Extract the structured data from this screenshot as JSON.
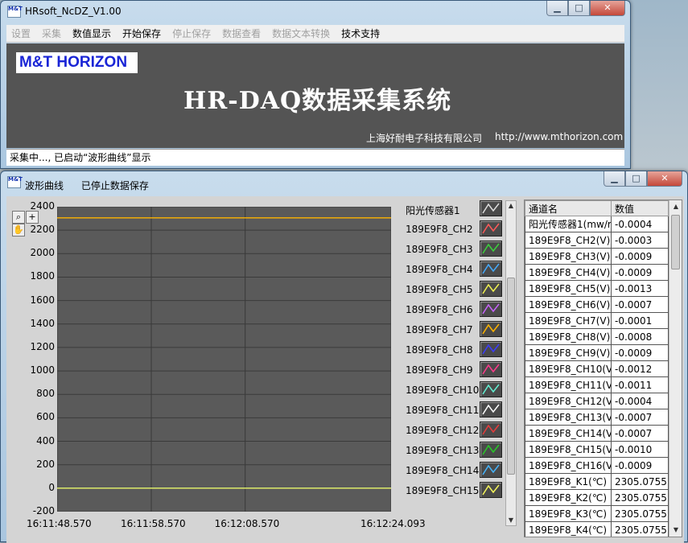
{
  "window1": {
    "title": "HRsoft_NcDZ_V1.00",
    "icon_text": "M&T",
    "menu": [
      {
        "label": "设置",
        "enabled": false
      },
      {
        "label": "采集",
        "enabled": false
      },
      {
        "label": "数值显示",
        "enabled": true
      },
      {
        "label": "开始保存",
        "enabled": true
      },
      {
        "label": "停止保存",
        "enabled": false
      },
      {
        "label": "数据查看",
        "enabled": false
      },
      {
        "label": "数据文本转换",
        "enabled": false
      },
      {
        "label": "技术支持",
        "enabled": true
      }
    ],
    "logo": "M&T HORIZON",
    "system_title": "HR-DAQ数据采集系统",
    "company": "上海好耐电子科技有限公司",
    "website": "http://www.mthorizon.com",
    "status": "采集中..., 已启动“波形曲线”显示"
  },
  "window2": {
    "status_left": "波形曲线",
    "status_right": "已停止数据保存",
    "chart_data": {
      "type": "line",
      "y_ticks": [
        "2400",
        "2200",
        "2000",
        "1800",
        "1600",
        "1400",
        "1200",
        "1000",
        "800",
        "600",
        "400",
        "200",
        "0",
        "-200"
      ],
      "ylim": [
        -200,
        2400
      ],
      "x_ticks": [
        "16:11:48.570",
        "16:11:58.570",
        "16:12:08.570",
        "16:12:24.093"
      ],
      "grid": true,
      "series": [
        {
          "name": "阳光传感器1",
          "color": "#dddddd",
          "level": 0
        },
        {
          "name": "189E9F8_CH2",
          "color": "#ff5a5a",
          "level": 0
        },
        {
          "name": "189E9F8_CH3",
          "color": "#3cd23c",
          "level": 0
        },
        {
          "name": "189E9F8_CH4",
          "color": "#46aaff",
          "level": 0
        },
        {
          "name": "189E9F8_CH5",
          "color": "#f0f050",
          "level": 0
        },
        {
          "name": "189E9F8_CH6",
          "color": "#c864ff",
          "level": 0
        },
        {
          "name": "189E9F8_CH7",
          "color": "#ffb400",
          "level": 2305.0755
        },
        {
          "name": "189E9F8_CH8",
          "color": "#3c3cff",
          "level": 0
        },
        {
          "name": "189E9F8_CH9",
          "color": "#ff3c8c",
          "level": 0
        },
        {
          "name": "189E9F8_CH10",
          "color": "#64f0d2",
          "level": 0
        },
        {
          "name": "189E9F8_CH11",
          "color": "#ffffff",
          "level": 0
        },
        {
          "name": "189E9F8_CH12",
          "color": "#e63c3c",
          "level": 0
        },
        {
          "name": "189E9F8_CH13",
          "color": "#28c828",
          "level": 0
        },
        {
          "name": "189E9F8_CH14",
          "color": "#46b4ff",
          "level": 0
        },
        {
          "name": "189E9F8_CH15",
          "color": "#f5f55a",
          "level": 0
        }
      ]
    },
    "table": {
      "headers": [
        "通道名",
        "数值"
      ],
      "rows": [
        [
          "阳光传感器1(mw/r",
          "-0.0004"
        ],
        [
          "189E9F8_CH2(V)",
          "-0.0003"
        ],
        [
          "189E9F8_CH3(V)",
          "-0.0009"
        ],
        [
          "189E9F8_CH4(V)",
          "-0.0009"
        ],
        [
          "189E9F8_CH5(V)",
          "-0.0013"
        ],
        [
          "189E9F8_CH6(V)",
          "-0.0007"
        ],
        [
          "189E9F8_CH7(V)",
          "-0.0001"
        ],
        [
          "189E9F8_CH8(V)",
          "-0.0008"
        ],
        [
          "189E9F8_CH9(V)",
          "-0.0009"
        ],
        [
          "189E9F8_CH10(V)",
          "-0.0012"
        ],
        [
          "189E9F8_CH11(V)",
          "-0.0011"
        ],
        [
          "189E9F8_CH12(V)",
          "-0.0004"
        ],
        [
          "189E9F8_CH13(V)",
          "-0.0007"
        ],
        [
          "189E9F8_CH14(V)",
          "-0.0007"
        ],
        [
          "189E9F8_CH15(V)",
          "-0.0010"
        ],
        [
          "189E9F8_CH16(V)",
          "-0.0009"
        ],
        [
          "189E9F8_K1(℃)",
          "2305.0755"
        ],
        [
          "189E9F8_K2(℃)",
          "2305.0755"
        ],
        [
          "189E9F8_K3(℃)",
          "2305.0755"
        ],
        [
          "189E9F8_K4(℃)",
          "2305.0755"
        ]
      ]
    }
  }
}
